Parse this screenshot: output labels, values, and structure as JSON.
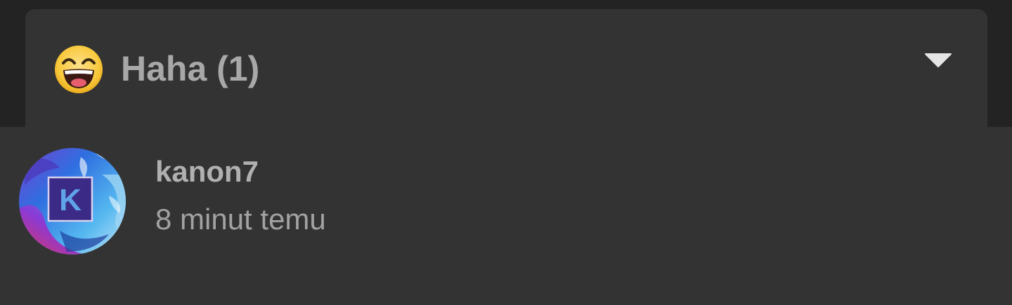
{
  "reaction": {
    "icon": "laughing-face-icon",
    "title": "Haha (1)",
    "toggle_icon": "chevron-down-icon"
  },
  "reactors": [
    {
      "username": "kanon7",
      "time": "8 minut temu",
      "avatar_letter": "K"
    }
  ],
  "colors": {
    "background": "#232323",
    "card": "#333333",
    "text_primary": "#b0b0b0",
    "text_secondary": "#a2a2a2"
  }
}
